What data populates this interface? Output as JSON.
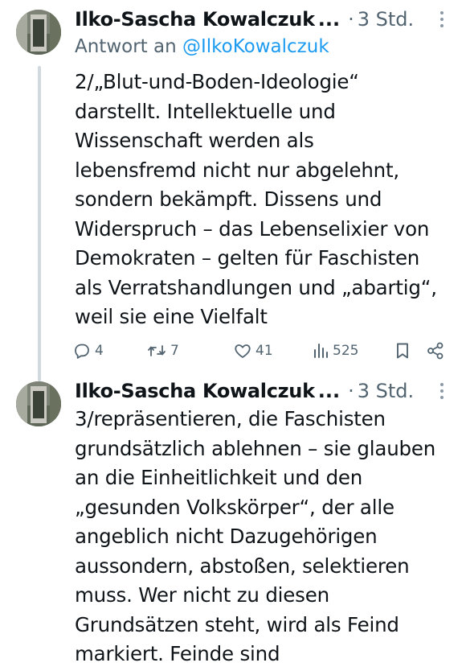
{
  "tweets": [
    {
      "author": "Ilko-Sascha Kowalczuk",
      "ellipsis": "...",
      "separator": "·",
      "time": "3 Std.",
      "reply_prefix": "Antwort an",
      "reply_handle": "@IlkoKowalczuk",
      "lines": [
        "2/„Blut-und-Boden-Ideologie“",
        "darstellt. Intellektuelle und",
        "Wissenschaft werden als",
        "lebensfremd nicht nur abgelehnt,",
        "sondern bekämpft. Dissens und",
        "Widerspruch – das Lebenselixier von",
        "Demokraten – gelten für Faschisten",
        "als Verratshandlungen und „abartig“,",
        "weil sie eine Vielfalt"
      ],
      "stats": {
        "replies": "4",
        "retweets": "7",
        "likes": "41",
        "views": "525"
      }
    },
    {
      "author": "Ilko-Sascha Kowalczuk",
      "ellipsis": "...",
      "separator": "·",
      "time": "3 Std.",
      "lines": [
        "3/repräsentieren, die Faschisten",
        "grundsätzlich ablehnen – sie glauben",
        "an die Einheitlichkeit und den",
        "„gesunden Volkskörper“, der alle",
        "angeblich nicht Dazugehörigen",
        "aussondern, abstoßen, selektieren",
        "muss. Wer nicht zu diesen",
        "Grundsätzen steht, wird als Feind",
        "markiert. Feinde sind"
      ]
    }
  ],
  "icons": {
    "reply": "comment-icon",
    "retweet": "retweet-icon",
    "like": "heart-icon",
    "views": "views-chart-icon",
    "bookmark": "bookmark-icon",
    "share": "share-icon",
    "more": "more-dots-icon"
  },
  "colors": {
    "text": "#0f1419",
    "secondary": "#536471",
    "link": "#1d9bf0",
    "thread_line": "#cfd9de"
  }
}
